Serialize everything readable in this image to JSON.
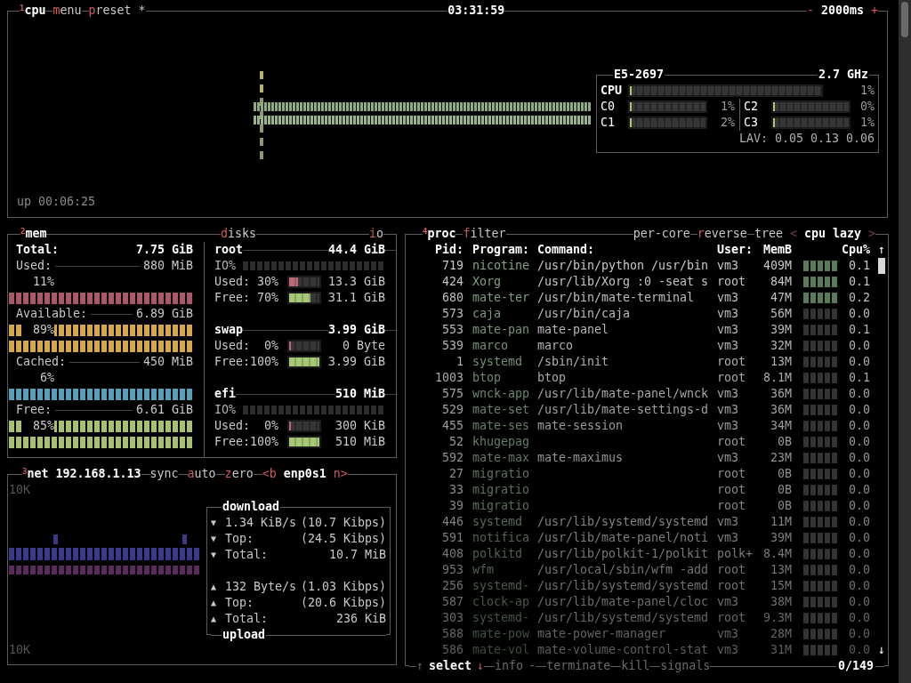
{
  "cpu_panel": {
    "header_left": [
      {
        "text": "$^{1}$cpu",
        "kind": "title"
      },
      {
        "text": "menu",
        "kind": "option"
      },
      {
        "text": "preset *",
        "kind": "option"
      }
    ],
    "clock": "03:31:59",
    "header_right": [
      {
        "text": "-",
        "kind": "key"
      },
      {
        "text": "2000ms",
        "kind": "value"
      },
      {
        "text": "+",
        "kind": "key"
      }
    ],
    "uptime": "up 00:06:25",
    "cpu_info": {
      "model": "E5-2697",
      "frequency": "2.7 GHz",
      "total": {
        "label": "CPU",
        "level": 0.01,
        "reading": "1%"
      },
      "cores": [
        {
          "label": "C0",
          "level": 0.01,
          "reading": "1%"
        },
        {
          "label": "C1",
          "level": 0.02,
          "reading": "2%"
        },
        {
          "label": "C2",
          "level": 0,
          "reading": "0%"
        },
        {
          "label": "C3",
          "level": 0.01,
          "reading": "1%"
        }
      ],
      "load_average": "LAV: 0.05 0.13 0.06"
    }
  },
  "memory": {
    "title": {
      "text": "$^{2}$mem",
      "kind": "title"
    },
    "total": {
      "label": "Total:",
      "value": "7.75 GiB"
    },
    "items": [
      {
        "label": "Used:",
        "value": "880 MiB",
        "percent": "11%",
        "kind": "low",
        "color": "#a85868"
      },
      {
        "label": "Available:",
        "value": "6.89 GiB",
        "percent": "89%",
        "kind": "high",
        "color": "#d4a848"
      },
      {
        "label": "Cached:",
        "value": "450 MiB",
        "percent": "6%",
        "kind": "low",
        "color": "#58a0b8"
      },
      {
        "label": "Free:",
        "value": "6.61 GiB",
        "percent": "85%",
        "kind": "high",
        "color": "#a8c070"
      }
    ]
  },
  "disks": {
    "title": {
      "text": "disks",
      "kind": "option"
    },
    "io_toggle": {
      "text": "io",
      "kind": "option"
    },
    "items": [
      {
        "name": "root",
        "size": "44.4 GiB",
        "io_label": "IO%",
        "used": {
          "label": "Used:",
          "percent": "30%",
          "level": 0.3,
          "value": "13.3 GiB"
        },
        "free": {
          "label": "Free:",
          "percent": "70%",
          "level": 0.7,
          "value": "31.1 GiB"
        }
      },
      {
        "name": "swap",
        "size": "3.99 GiB",
        "used": {
          "label": "Used:",
          "percent": "0%",
          "level": 0,
          "value": "0 Byte"
        },
        "free": {
          "label": "Free:",
          "percent": "100%",
          "level": 1,
          "value": "3.99 GiB"
        }
      },
      {
        "name": "efi",
        "size": "510 MiB",
        "io_label": "IO%",
        "used": {
          "label": "Used:",
          "percent": "0%",
          "level": 0,
          "value": "300 KiB"
        },
        "free": {
          "label": "Free:",
          "percent": "100%",
          "level": 1,
          "value": "510 MiB"
        }
      }
    ]
  },
  "network": {
    "header": [
      {
        "text": "$^{3}$net",
        "kind": "title"
      },
      {
        "text": "192.168.1.13",
        "kind": "value"
      },
      {
        "text": "sync",
        "kind": "plain"
      },
      {
        "text": "auto",
        "kind": "option"
      },
      {
        "text": "zero",
        "kind": "option"
      },
      {
        "text": "<b",
        "kind": "key"
      },
      {
        "text": "enp0s1",
        "kind": "value"
      },
      {
        "text": "n>",
        "kind": "key"
      }
    ],
    "scale_top": "10K",
    "scale_bottom": "10K",
    "download": {
      "title": "download",
      "rows": [
        {
          "arrow": "▼",
          "label": "1.34 KiB/s",
          "value": "(10.7 Kibps)"
        },
        {
          "arrow": "▼",
          "label": "Top:",
          "value": "(24.5 Kibps)"
        },
        {
          "arrow": "▼",
          "label": "Total:",
          "value": "10.7 MiB"
        }
      ]
    },
    "upload": {
      "title": "upload",
      "rows": [
        {
          "arrow": "▲",
          "label": "132 Byte/s",
          "value": "(1.03 Kibps)"
        },
        {
          "arrow": "▲",
          "label": "Top:",
          "value": "(20.6 Kibps)"
        },
        {
          "arrow": "▲",
          "label": "Total:",
          "value": "236 KiB"
        }
      ]
    }
  },
  "processes": {
    "header_left": [
      {
        "text": "$^{4}$proc",
        "kind": "title"
      },
      {
        "text": "filter",
        "kind": "option"
      }
    ],
    "header_right": [
      {
        "text": "per-core",
        "kind": "plain"
      },
      {
        "text": "reverse",
        "kind": "option"
      },
      {
        "text": "tree",
        "kind": "plain"
      },
      {
        "text": "<",
        "kind": "dimkey"
      },
      {
        "text": "cpu lazy",
        "kind": "value"
      },
      {
        "text": ">",
        "kind": "dimkey"
      }
    ],
    "columns": [
      "Pid:",
      "Program:",
      "Command:",
      "User:",
      "MemB",
      "Cpu%"
    ],
    "scroll_up": "↑",
    "scroll_down": "↓",
    "rows": [
      {
        "pid": "719",
        "program": "nicotine",
        "command": "/usr/bin/python /usr/bin",
        "user": "vm3",
        "mem": "409M",
        "cpu": "0.1"
      },
      {
        "pid": "424",
        "program": "Xorg",
        "command": "/usr/lib/Xorg :0 -seat s",
        "user": "root",
        "mem": "84M",
        "cpu": "0.1"
      },
      {
        "pid": "680",
        "program": "mate-ter",
        "command": "/usr/bin/mate-terminal",
        "user": "vm3",
        "mem": "47M",
        "cpu": "0.2"
      },
      {
        "pid": "573",
        "program": "caja",
        "command": "/usr/bin/caja",
        "user": "vm3",
        "mem": "56M",
        "cpu": "0.0"
      },
      {
        "pid": "553",
        "program": "mate-pan",
        "command": "mate-panel",
        "user": "vm3",
        "mem": "39M",
        "cpu": "0.1"
      },
      {
        "pid": "539",
        "program": "marco",
        "command": "marco",
        "user": "vm3",
        "mem": "32M",
        "cpu": "0.0"
      },
      {
        "pid": "1",
        "program": "systemd",
        "command": "/sbin/init",
        "user": "root",
        "mem": "13M",
        "cpu": "0.0"
      },
      {
        "pid": "1003",
        "program": "btop",
        "command": "btop",
        "user": "root",
        "mem": "8.1M",
        "cpu": "0.1"
      },
      {
        "pid": "575",
        "program": "wnck-app",
        "command": "/usr/lib/mate-panel/wnck",
        "user": "vm3",
        "mem": "36M",
        "cpu": "0.0"
      },
      {
        "pid": "529",
        "program": "mate-set",
        "command": "/usr/lib/mate-settings-d",
        "user": "vm3",
        "mem": "36M",
        "cpu": "0.0"
      },
      {
        "pid": "455",
        "program": "mate-ses",
        "command": "mate-session",
        "user": "vm3",
        "mem": "34M",
        "cpu": "0.0"
      },
      {
        "pid": "52",
        "program": "khugepag",
        "user": "root",
        "mem": "0B",
        "cpu": "0.0"
      },
      {
        "pid": "592",
        "program": "mate-max",
        "command": "mate-maximus",
        "user": "vm3",
        "mem": "23M",
        "cpu": "0.0"
      },
      {
        "pid": "27",
        "program": "migratio",
        "user": "root",
        "mem": "0B",
        "cpu": "0.0"
      },
      {
        "pid": "33",
        "program": "migratio",
        "user": "root",
        "mem": "0B",
        "cpu": "0.0"
      },
      {
        "pid": "39",
        "program": "migratio",
        "user": "root",
        "mem": "0B",
        "cpu": "0.0"
      },
      {
        "pid": "446",
        "program": "systemd",
        "command": "/usr/lib/systemd/systemd",
        "user": "vm3",
        "mem": "11M",
        "cpu": "0.0"
      },
      {
        "pid": "591",
        "program": "notifica",
        "command": "/usr/lib/mate-panel/noti",
        "user": "vm3",
        "mem": "39M",
        "cpu": "0.0"
      },
      {
        "pid": "408",
        "program": "polkitd",
        "command": "/usr/lib/polkit-1/polkit",
        "user": "polk+",
        "mem": "8.4M",
        "cpu": "0.0"
      },
      {
        "pid": "953",
        "program": "wfm",
        "command": "/usr/local/sbin/wfm -add",
        "user": "root",
        "mem": "13M",
        "cpu": "0.0"
      },
      {
        "pid": "256",
        "program": "systemd-",
        "command": "/usr/lib/systemd/systemd",
        "user": "root",
        "mem": "15M",
        "cpu": "0.0"
      },
      {
        "pid": "587",
        "program": "clock-ap",
        "command": "/usr/lib/mate-panel/cloc",
        "user": "vm3",
        "mem": "38M",
        "cpu": "0.0"
      },
      {
        "pid": "303",
        "program": "systemd-",
        "command": "/usr/lib/systemd/systemd",
        "user": "root",
        "mem": "9.3M",
        "cpu": "0.0"
      },
      {
        "pid": "588",
        "program": "mate-pow",
        "command": "mate-power-manager",
        "user": "vm3",
        "mem": "28M",
        "cpu": "0.0"
      },
      {
        "pid": "586",
        "program": "mate-vol",
        "command": "mate-volume-control-stat",
        "user": "vm3",
        "mem": "31M",
        "cpu": "0.0"
      }
    ],
    "footer": [
      {
        "text": "↑",
        "kind": "dim"
      },
      {
        "text": "select",
        "kind": "value"
      },
      {
        "text": "↓",
        "kind": "key"
      },
      {
        "text": "info",
        "kind": "dim"
      },
      {
        "text": "-",
        "kind": "dim"
      },
      {
        "text": "terminate",
        "kind": "dim"
      },
      {
        "text": "kill",
        "kind": "dim"
      },
      {
        "text": "signals",
        "kind": "dim"
      }
    ],
    "count": "0/149"
  }
}
